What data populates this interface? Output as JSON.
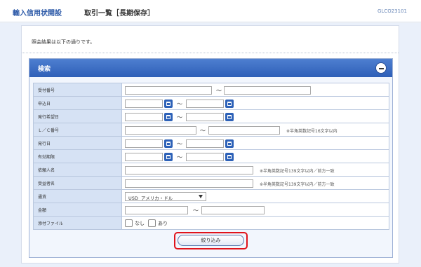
{
  "header": {
    "app_title": "輸入信用状開設",
    "page_title": "取引一覧［長期保存］",
    "screen_code": "GLCO23101"
  },
  "message": "照会結果は以下の通りです。",
  "search_panel": {
    "title": "検索",
    "rows": {
      "receipt_no": {
        "label": "受付番号",
        "tilde": "～"
      },
      "application_date": {
        "label": "申込日",
        "tilde": "～"
      },
      "issue_request_date": {
        "label": "発行希望日",
        "tilde": "～"
      },
      "lc_no": {
        "label": "Ｌ／Ｃ番号",
        "tilde": "～",
        "hint": "※半角英数記号16文字以内"
      },
      "issue_date": {
        "label": "発行日",
        "tilde": "～"
      },
      "expiry_date": {
        "label": "有効期限",
        "tilde": "～"
      },
      "applicant": {
        "label": "依頼人名",
        "hint": "※半角英数記号139文字以内／前方一致"
      },
      "beneficiary": {
        "label": "受益者名",
        "hint": "※半角英数記号139文字以内／前方一致"
      },
      "currency": {
        "label": "通貨",
        "selected": "USD  アメリカ・ドル"
      },
      "amount": {
        "label": "金額",
        "tilde": "～"
      },
      "attachment": {
        "label": "添付ファイル",
        "option_none": "なし",
        "option_yes": "あり"
      }
    },
    "filter_button": "絞り込み"
  },
  "colors": {
    "accent": "#2e5fb8",
    "highlight": "#e0131b",
    "label_bg": "#d6e2f4"
  },
  "icons": {
    "calendar": "calendar-icon",
    "collapse": "minus-circle-icon",
    "dropdown": "chevron-down-icon"
  }
}
